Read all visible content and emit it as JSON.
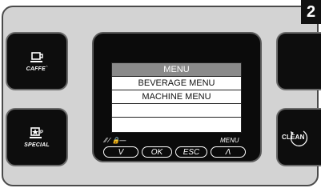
{
  "step_number": "2",
  "left_buttons": [
    {
      "label": "CAFFE`",
      "icon": "coffee-cup-icon"
    },
    {
      "label": "SPECIAL",
      "icon": "special-star-cup-icon"
    }
  ],
  "right_buttons": [
    {
      "label": "",
      "icon": ""
    },
    {
      "label": "CLEAN",
      "icon": "clean-icon"
    }
  ],
  "display": {
    "rows": [
      "MENU",
      "BEVERAGE MENU",
      "MACHINE MENU",
      ""
    ],
    "left_legend": "⁄⁄ ⁄ 🔒—",
    "right_legend": "MENU"
  },
  "soft_keys": [
    "V",
    "OK",
    "ESC",
    "Λ"
  ]
}
